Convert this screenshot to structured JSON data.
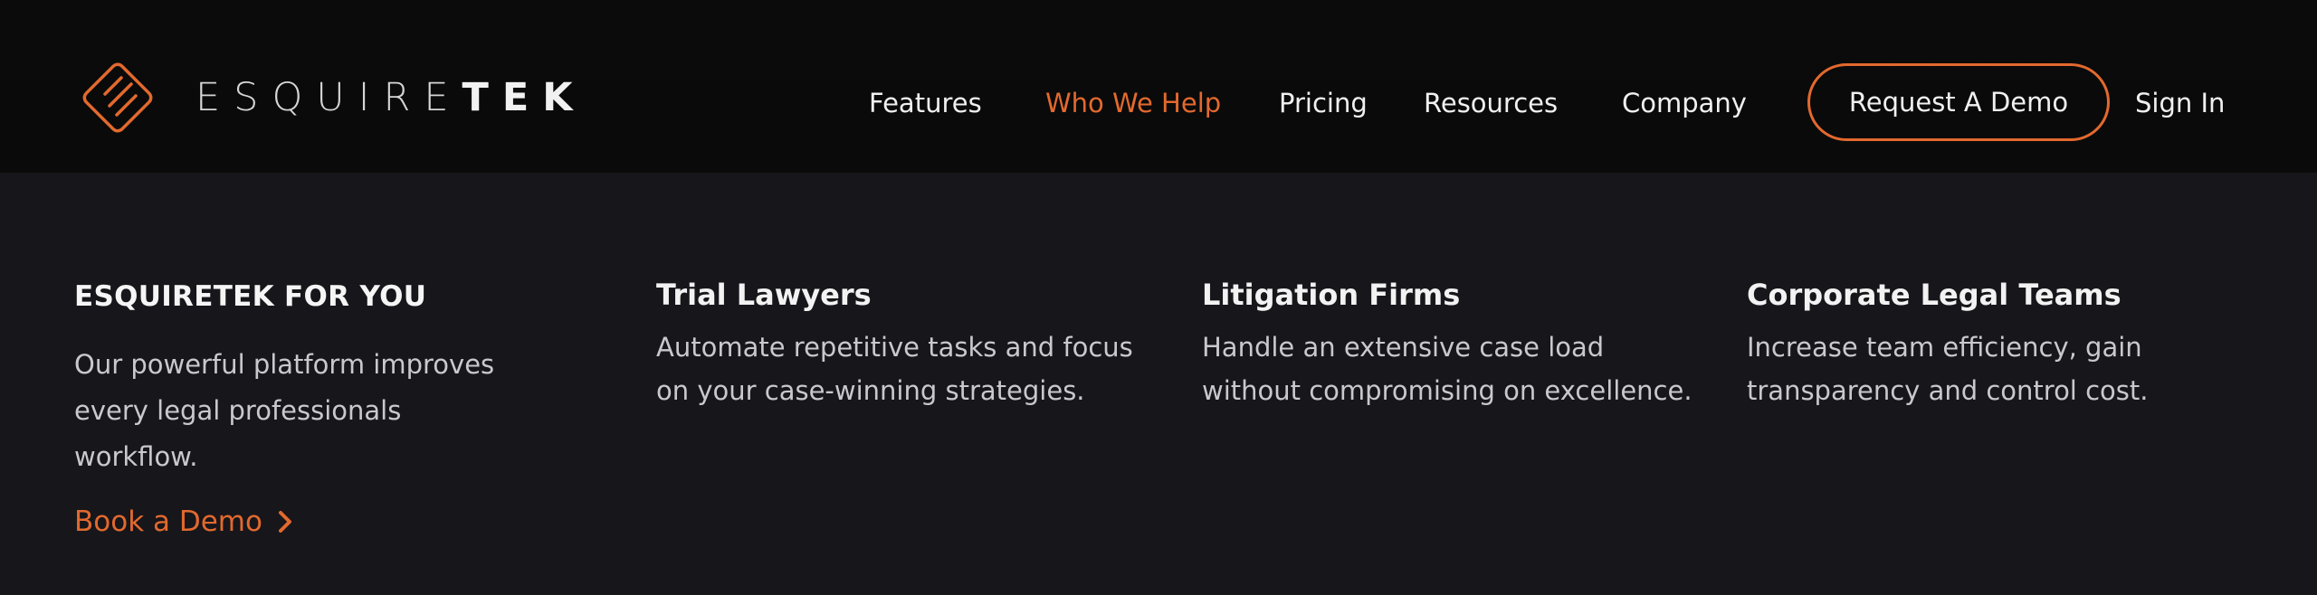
{
  "header": {
    "logo": {
      "text_light": "ESQUIRE",
      "text_bold": "TEK"
    },
    "nav": [
      {
        "label": "Features",
        "active": false
      },
      {
        "label": "Who We Help",
        "active": true
      },
      {
        "label": "Pricing",
        "active": false
      },
      {
        "label": "Resources",
        "active": false
      },
      {
        "label": "Company",
        "active": false
      }
    ],
    "cta_label": "Request A Demo",
    "signin_label": "Sign In"
  },
  "menu": {
    "intro": {
      "title": "ESQUIRETEK FOR YOU",
      "body": "Our powerful platform improves every legal professionals workflow.",
      "link_label": "Book a Demo"
    },
    "columns": [
      {
        "title": "Trial Lawyers",
        "line1": "Automate repetitive tasks and focus",
        "line2": "on your case-winning strategies."
      },
      {
        "title": "Litigation Firms",
        "line1": "Handle an extensive case load",
        "line2": "without compromising on excellence."
      },
      {
        "title": "Corporate Legal Teams",
        "line1": "Increase team efficiency, gain",
        "line2": "transparency and control cost."
      }
    ]
  },
  "colors": {
    "accent": "#e2692e",
    "header_bg": "#0b0b0b",
    "menu_bg": "#17161b",
    "text_primary": "#f0f0f0",
    "text_secondary": "#c9c9cc"
  },
  "icons": {
    "logo_mark": "diamond-lines-icon",
    "link_arrow": "chevron-right-icon"
  }
}
